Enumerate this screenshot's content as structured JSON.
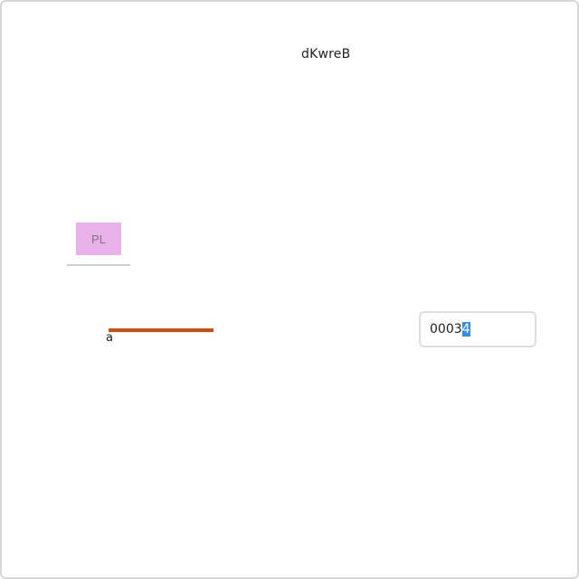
{
  "window": {
    "title": "dKwreB"
  },
  "tag_button": {
    "label": "PL"
  },
  "progress": {
    "label": "a",
    "value_percent": 100
  },
  "number_input": {
    "value_unselected": "0003",
    "value_selected": "4"
  },
  "colors": {
    "tag_bg": "#e8b1ea",
    "progress_fill": "#d64b06",
    "selection": "#2f8fe8"
  }
}
